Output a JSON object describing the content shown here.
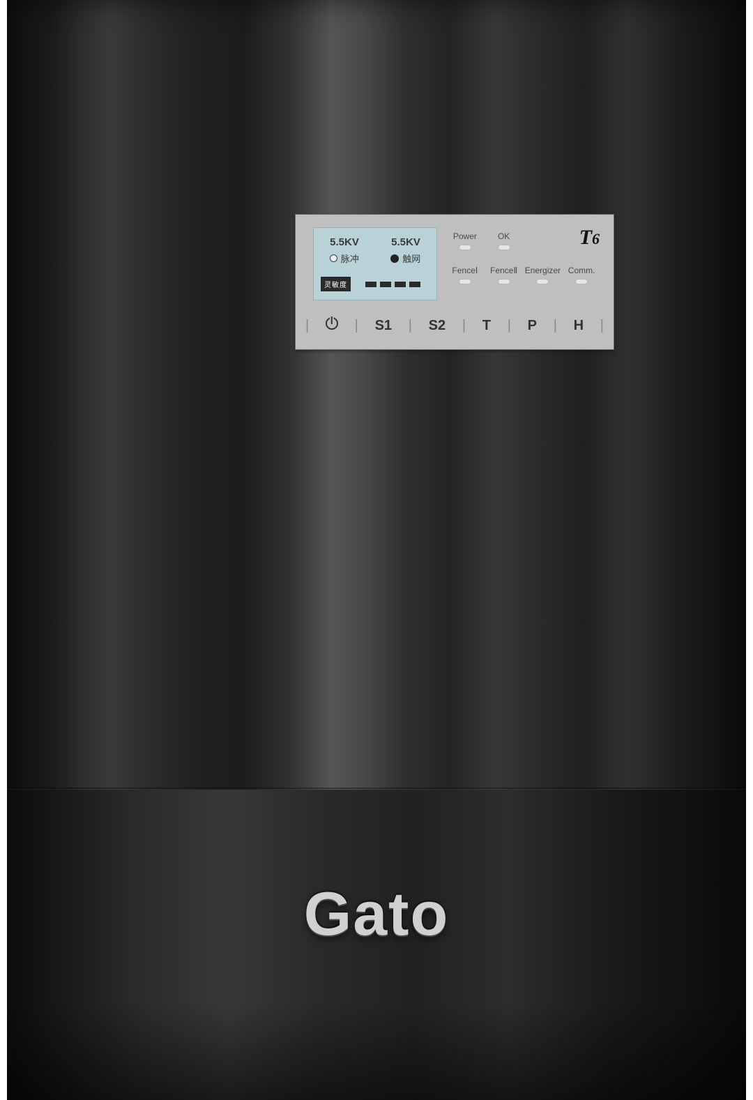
{
  "model": {
    "prefix": "T",
    "suffix": "6"
  },
  "lcd": {
    "kv_left": "5.5KV",
    "kv_right": "5.5KV",
    "pulse_label": "脉冲",
    "touch_label": "触网",
    "sensitivity_label": "灵敏度"
  },
  "status_top": [
    {
      "label": "Power"
    },
    {
      "label": "OK"
    }
  ],
  "status_bottom": [
    {
      "label": "FenceⅠ"
    },
    {
      "label": "FenceⅡ"
    },
    {
      "label": "Energizer"
    },
    {
      "label": "Comm."
    }
  ],
  "buttons": {
    "s1": "S1",
    "s2": "S2",
    "t": "T",
    "p": "P",
    "h": "H"
  },
  "brand": "Gato"
}
